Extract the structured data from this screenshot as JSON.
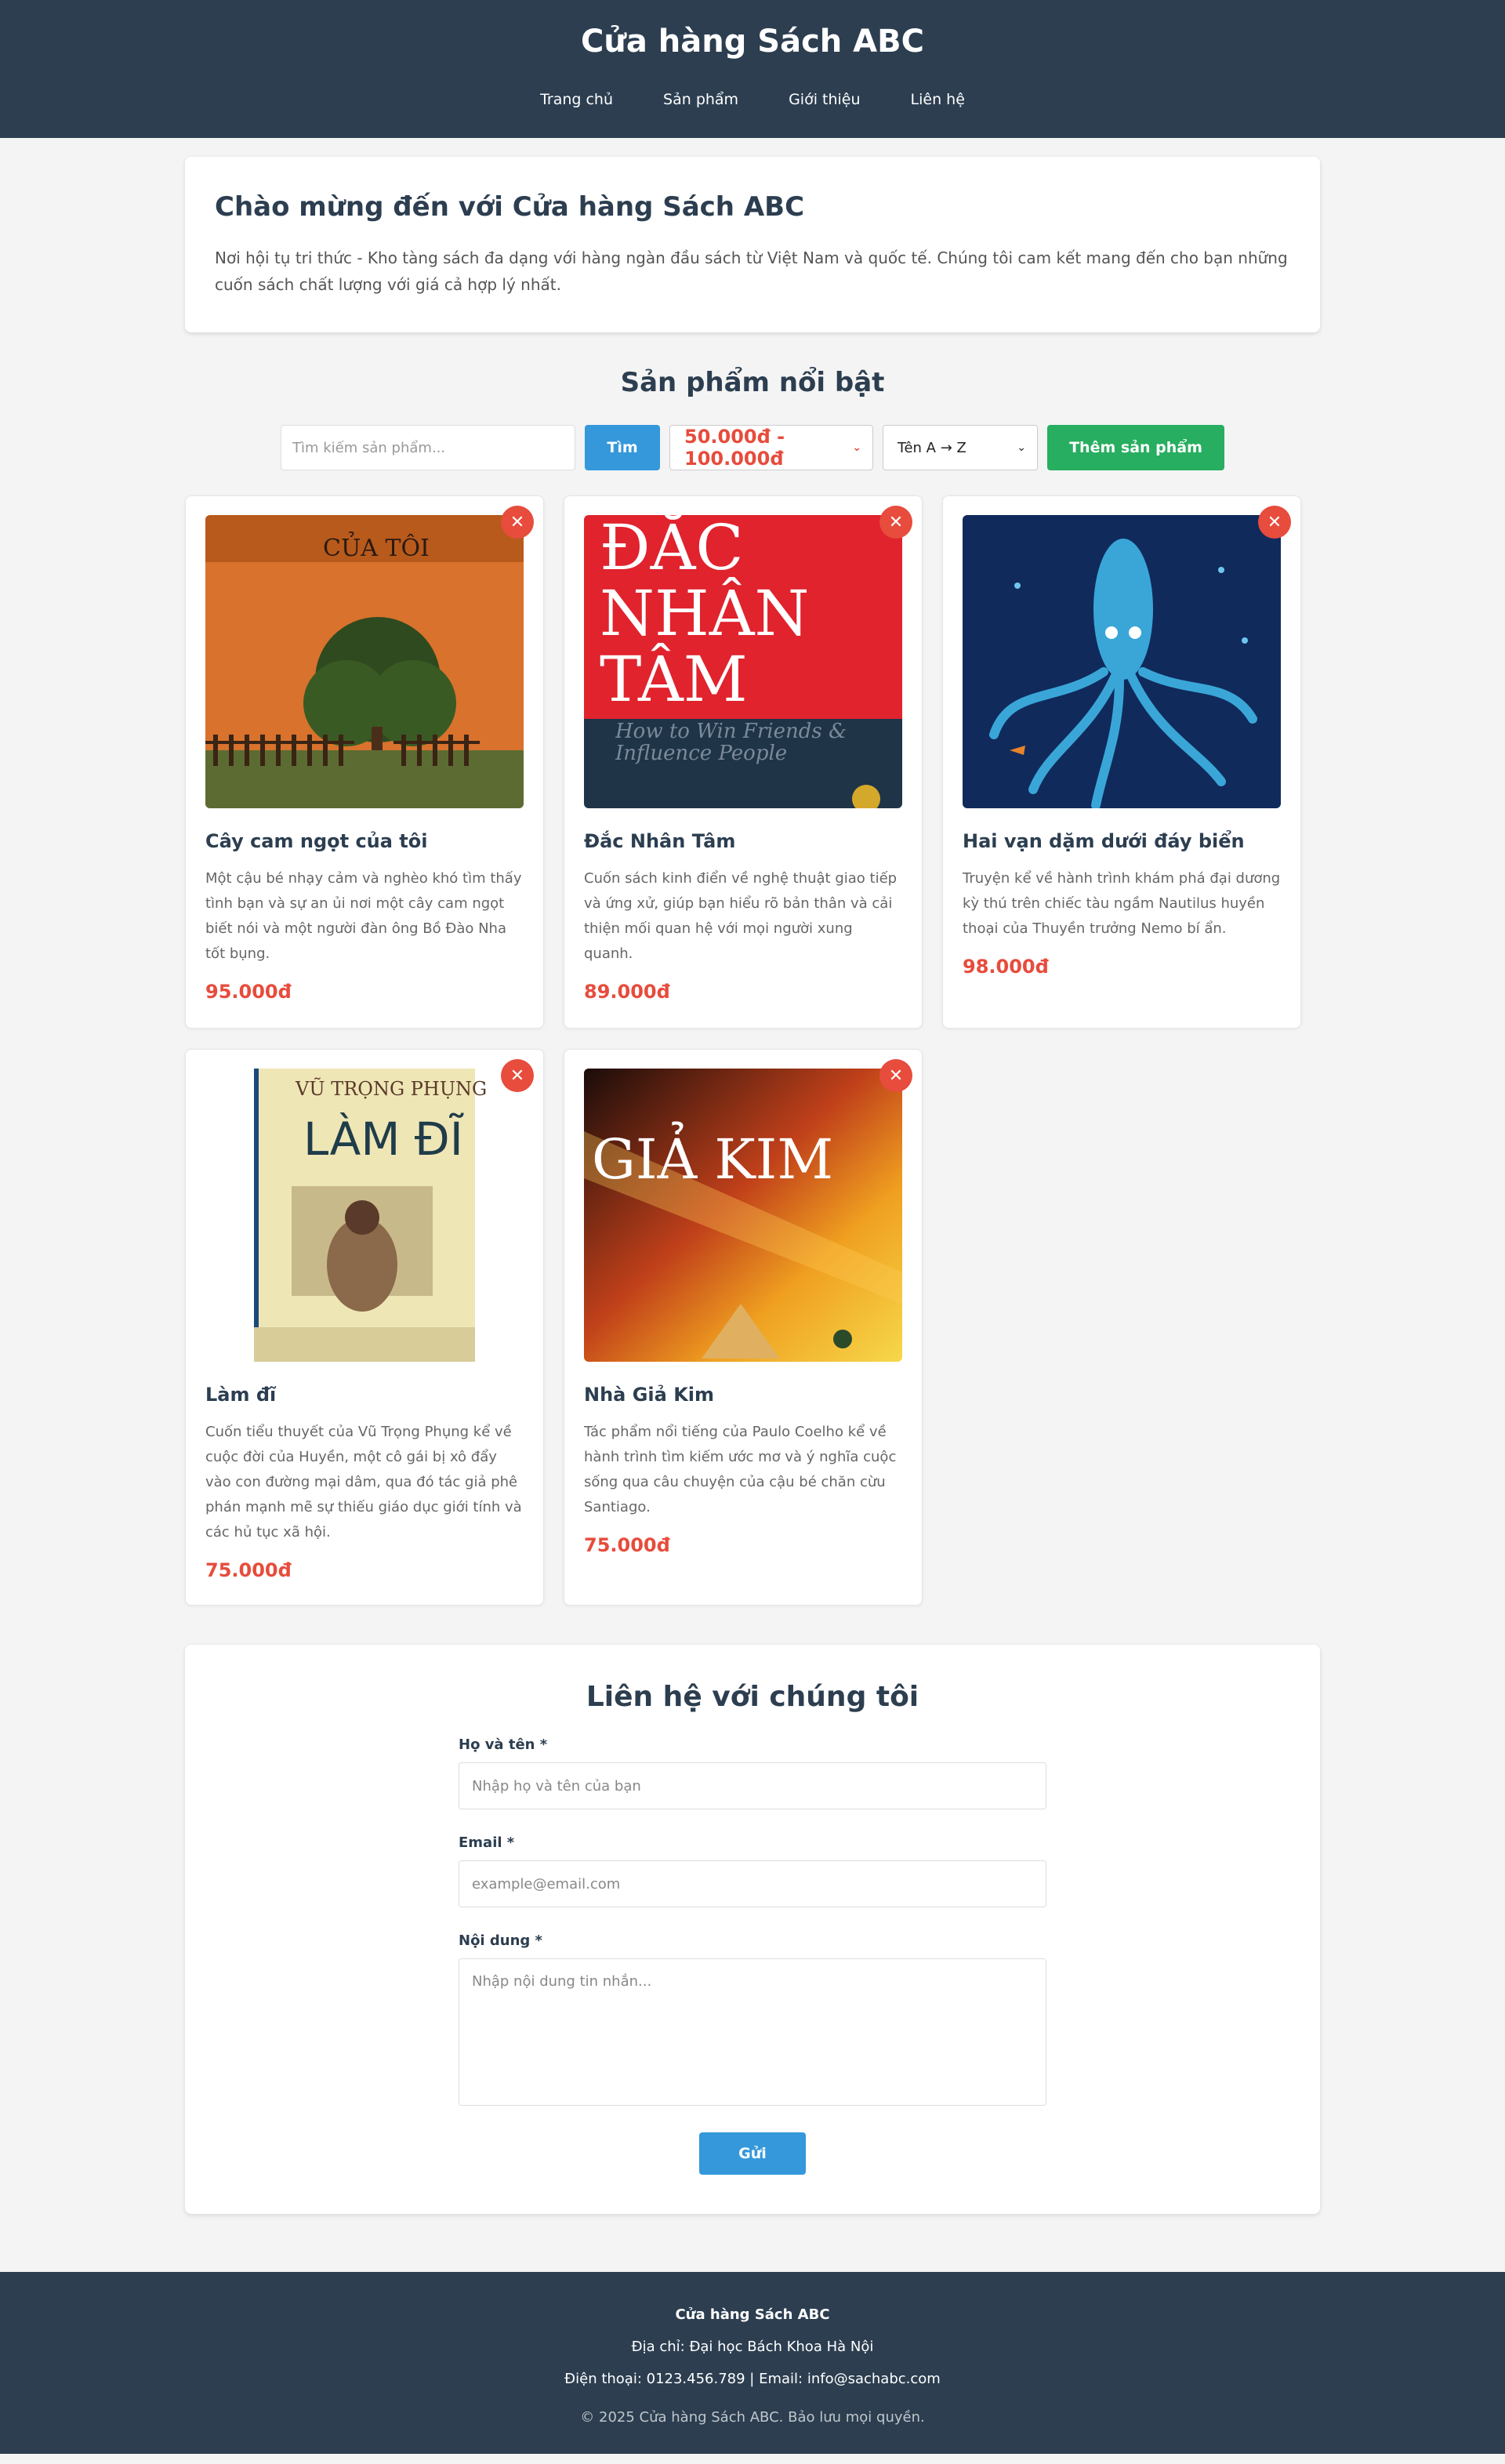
{
  "header": {
    "title": "Cửa hàng Sách ABC",
    "nav": [
      "Trang chủ",
      "Sản phẩm",
      "Giới thiệu",
      "Liên hệ"
    ]
  },
  "welcome": {
    "title": "Chào mừng đến với Cửa hàng Sách ABC",
    "text": "Nơi hội tụ tri thức - Kho tàng sách đa dạng với hàng ngàn đầu sách từ Việt Nam và quốc tế. Chúng tôi cam kết mang đến cho bạn những cuốn sách chất lượng với giá cả hợp lý nhất."
  },
  "products": {
    "title": "Sản phẩm nổi bật",
    "search_placeholder": "Tìm kiếm sản phẩm...",
    "search_button": "Tìm",
    "price_filter": "50.000đ - 100.000đ",
    "sort": "Tên A → Z",
    "add_button": "Thêm sản phẩm",
    "items": [
      {
        "title": "Cây cam ngọt của tôi",
        "desc": "Một cậu bé nhạy cảm và nghèo khó tìm thấy tình bạn và sự an ủi nơi một cây cam ngọt biết nói và một người đàn ông Bồ Đào Nha tốt bụng.",
        "price": "95.000đ",
        "cover_text": "CỦA TÔI"
      },
      {
        "title": "Đắc Nhân Tâm",
        "desc": "Cuốn sách kinh điển về nghệ thuật giao tiếp và ứng xử, giúp bạn hiểu rõ bản thân và cải thiện mối quan hệ với mọi người xung quanh.",
        "price": "89.000đ",
        "cover_text": "ĐẮC NHÂN TÂM",
        "cover_sub": "How to Win Friends & Influence People"
      },
      {
        "title": "Hai vạn dặm dưới đáy biển",
        "desc": "Truyện kể về hành trình khám phá đại dương kỳ thú trên chiếc tàu ngầm Nautilus huyền thoại của Thuyền trưởng Nemo bí ẩn.",
        "price": "98.000đ"
      },
      {
        "title": "Làm đĩ",
        "desc": "Cuốn tiểu thuyết của Vũ Trọng Phụng kể về cuộc đời của Huyền, một cô gái bị xô đẩy vào con đường mại dâm, qua đó tác giả phê phán mạnh mẽ sự thiếu giáo dục giới tính và các hủ tục xã hội.",
        "price": "75.000đ",
        "cover_author": "VŨ TRỌNG PHỤNG",
        "cover_text": "LÀM ĐĨ"
      },
      {
        "title": "Nhà Giả Kim",
        "desc": "Tác phẩm nổi tiếng của Paulo Coelho kể về hành trình tìm kiếm ước mơ và ý nghĩa cuộc sống qua câu chuyện của cậu bé chăn cừu Santiago.",
        "price": "75.000đ",
        "cover_text": "GIẢ KIM"
      }
    ]
  },
  "contact": {
    "title": "Liên hệ với chúng tôi",
    "name_label": "Họ và tên *",
    "name_placeholder": "Nhập họ và tên của bạn",
    "email_label": "Email *",
    "email_placeholder": "example@email.com",
    "message_label": "Nội dung *",
    "message_placeholder": "Nhập nội dung tin nhắn...",
    "send_button": "Gửi"
  },
  "footer": {
    "title": "Cửa hàng Sách ABC",
    "address": "Địa chỉ: Đại học Bách Khoa Hà Nội",
    "phone_email": "Điện thoại: 0123.456.789 | Email: info@sachabc.com",
    "copyright": "© 2025 Cửa hàng Sách ABC. Bảo lưu mọi quyền."
  },
  "colors": {
    "header_bg": "#2c3e50",
    "primary": "#3498db",
    "success": "#27ae60",
    "danger": "#e74c3c"
  }
}
